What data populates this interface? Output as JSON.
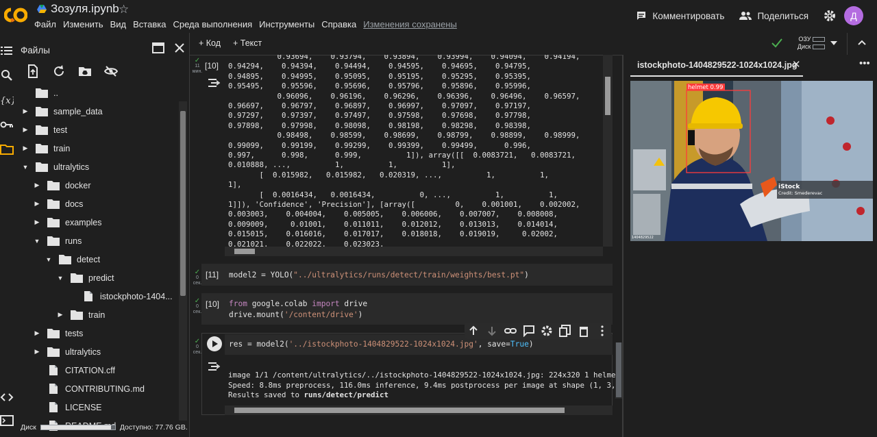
{
  "app": {
    "logo_text": "CO",
    "title": "Зозуля.ipynb",
    "menu": [
      "Файл",
      "Изменить",
      "Вид",
      "Вставка",
      "Среда выполнения",
      "Инструменты",
      "Справка",
      "Изменения сохранены"
    ],
    "comment_label": "Комментировать",
    "share_label": "Поделиться",
    "avatar_letter": "Д",
    "accent": "#f9ab00"
  },
  "files_panel": {
    "title": "Файлы",
    "tree": [
      {
        "label": "..",
        "depth": 0,
        "type": "folder",
        "caret": ""
      },
      {
        "label": "sample_data",
        "depth": 0,
        "type": "folder",
        "caret": "▶"
      },
      {
        "label": "test",
        "depth": 0,
        "type": "folder",
        "caret": "▶"
      },
      {
        "label": "train",
        "depth": 0,
        "type": "folder",
        "caret": "▶"
      },
      {
        "label": "ultralytics",
        "depth": 0,
        "type": "folder",
        "caret": "▼"
      },
      {
        "label": "docker",
        "depth": 1,
        "type": "folder",
        "caret": "▶"
      },
      {
        "label": "docs",
        "depth": 1,
        "type": "folder",
        "caret": "▶"
      },
      {
        "label": "examples",
        "depth": 1,
        "type": "folder",
        "caret": "▶"
      },
      {
        "label": "runs",
        "depth": 1,
        "type": "folder",
        "caret": "▼"
      },
      {
        "label": "detect",
        "depth": 2,
        "type": "folder",
        "caret": "▼"
      },
      {
        "label": "predict",
        "depth": 3,
        "type": "folder",
        "caret": "▼"
      },
      {
        "label": "istockphoto-1404...",
        "depth": 4,
        "type": "file",
        "caret": ""
      },
      {
        "label": "train",
        "depth": 3,
        "type": "folder",
        "caret": "▶"
      },
      {
        "label": "tests",
        "depth": 1,
        "type": "folder",
        "caret": "▶"
      },
      {
        "label": "ultralytics",
        "depth": 1,
        "type": "folder",
        "caret": "▶"
      },
      {
        "label": "CITATION.cff",
        "depth": 1,
        "type": "file",
        "caret": ""
      },
      {
        "label": "CONTRIBUTING.md",
        "depth": 1,
        "type": "file",
        "caret": ""
      },
      {
        "label": "LICENSE",
        "depth": 1,
        "type": "file",
        "caret": ""
      },
      {
        "label": "README.md",
        "depth": 1,
        "type": "file",
        "caret": ""
      }
    ],
    "disk_label": "Диск",
    "disk_free": "Доступно: 77.76 GB.",
    "disk_used_fraction": 0.95
  },
  "toolbar": {
    "add_code": "+ Код",
    "add_text": "+ Текст",
    "ram_label": "ОЗУ",
    "disk_label": "Диск"
  },
  "cells": {
    "c10a": {
      "exec": "[10]",
      "status_time": "11",
      "status_unit": "мин.",
      "output": [
        "           0.93694,    0.93794,    0.93894,    0.93994,    0.94094,    0.94194,",
        "0.94294,    0.94394,    0.94494,    0.94595,    0.94695,    0.94795,",
        "0.94895,    0.94995,    0.95095,    0.95195,    0.95295,    0.95395,",
        "0.95495,    0.95596,    0.95696,    0.95796,    0.95896,    0.95996,",
        "           0.96096,    0.96196,    0.96296,    0.96396,    0.96496,    0.96597,",
        "0.96697,    0.96797,    0.96897,    0.96997,    0.97097,    0.97197,",
        "0.97297,    0.97397,    0.97497,    0.97598,    0.97698,    0.97798,",
        "0.97898,    0.97998,    0.98098,    0.98198,    0.98298,    0.98398,",
        "           0.98498,    0.98599,    0.98699,    0.98799,    0.98899,    0.98999,",
        "0.99099,    0.99199,    0.99299,    0.99399,    0.99499,      0.996,",
        "0.997,      0.998,      0.999,          1]), array([[  0.0083721,   0.0083721,",
        "0.010888, ...,          1,          1,          1],",
        "       [  0.015982,   0.015982,   0.020319, ...,          1,          1,",
        "1],",
        "       [  0.0016434,   0.0016434,          0, ...,          1,          1,",
        "1]]), 'Confidence', 'Precision'], [array([         0,    0.001001,    0.002002,",
        "0.003003,    0.004004,    0.005005,    0.006006,    0.007007,    0.008008,",
        "0.009009,     0.01001,    0.011011,    0.012012,    0.013013,    0.014014,",
        "0.015015,    0.016016,    0.017017,    0.018018,    0.019019,     0.02002,",
        "0.021021,    0.022022,    0.023023,"
      ]
    },
    "c11": {
      "exec": "[11]",
      "status_time": "0",
      "status_unit": "сек.",
      "code_a": "model2 = YOLO(",
      "code_str": "\"../ultralytics/runs/detect/train/weights/best.pt\"",
      "code_b": ")"
    },
    "c10b": {
      "exec": "[10]",
      "status_time": "0",
      "status_unit": "сек.",
      "line1_kw1": "from",
      "line1_mid": " google.colab ",
      "line1_kw2": "import",
      "line1_end": " drive",
      "line2_a": "drive.mount(",
      "line2_str": "'/content/drive'",
      "line2_b": ")"
    },
    "c_run": {
      "status_time": "0",
      "status_unit": "сек.",
      "code_a": "res = model2(",
      "code_str": "'../istockphoto-1404829522-1024x1024.jpg'",
      "code_b": ", save=",
      "code_kw": "True",
      "code_c": ")",
      "output": [
        "image 1/1 /content/ultralytics/../istockphoto-1404829522-1024x1024.jpg: 224x320 1 helme",
        "Speed: 8.8ms preprocess, 116.0ms inference, 9.4ms postprocess per image at shape (1, 3,"
      ],
      "output3_a": "Results saved to ",
      "output3_b": "runs/detect/predict"
    }
  },
  "right_panel": {
    "tab_label": "istockphoto-1404829522-1024x1024.jpg",
    "detection_label": "helmet 0.99",
    "watermark": "iStock",
    "credit": "Credit: Smederevac",
    "image_id": "1404829522"
  }
}
